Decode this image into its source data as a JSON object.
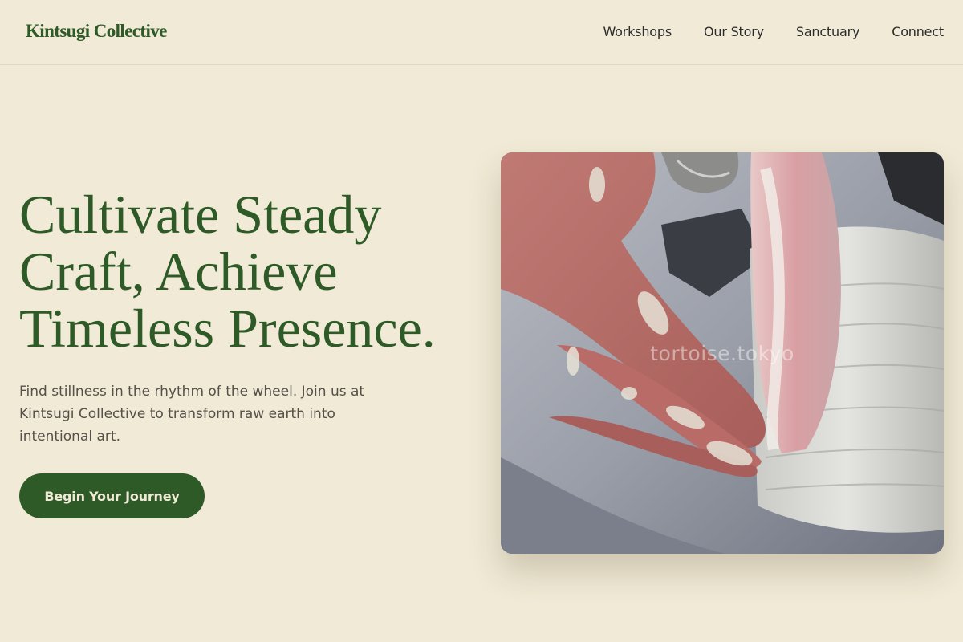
{
  "brand": {
    "name": "Kintsugi Collective"
  },
  "nav": {
    "items": [
      {
        "label": "Workshops"
      },
      {
        "label": "Our Story"
      },
      {
        "label": "Sanctuary"
      },
      {
        "label": "Connect"
      }
    ]
  },
  "hero": {
    "headline_lines": [
      "Cultivate Steady",
      "Craft, Achieve",
      "Timeless Presence."
    ],
    "subtext": "Find stillness in the rhythm of the wheel. Join us at Kintsugi Collective to transform raw earth into intentional art.",
    "cta_label": "Begin Your Journey",
    "image_watermark": "tortoise.tokyo"
  },
  "colors": {
    "background": "#f0ead6",
    "accent": "#2d5a27",
    "body_text": "#555049"
  }
}
